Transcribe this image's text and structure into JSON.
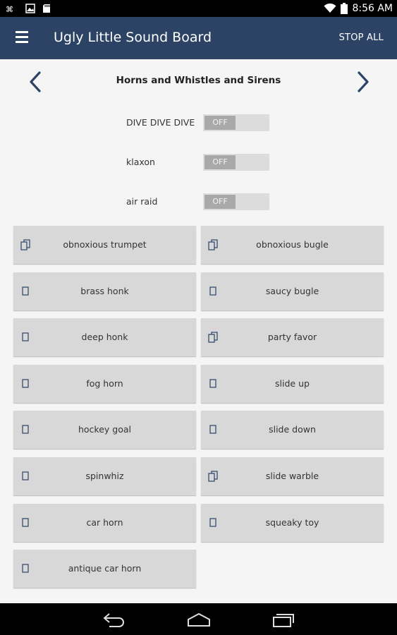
{
  "status_bar": {
    "time": "8:56 AM",
    "left_icons": [
      "voicemail-icon",
      "image-icon",
      "sd-card-icon"
    ],
    "right_icons": [
      "wifi-icon",
      "battery-icon"
    ]
  },
  "app_bar": {
    "title": "Ugly Little Sound Board",
    "stop_all_label": "STOP ALL",
    "background": "#2c4366"
  },
  "category": {
    "title": "Horns and Whistles and Sirens"
  },
  "toggles": [
    {
      "label": "DIVE DIVE DIVE",
      "state": "OFF"
    },
    {
      "label": "klaxon",
      "state": "OFF"
    },
    {
      "label": "air raid",
      "state": "OFF"
    }
  ],
  "sounds": [
    {
      "label": "obnoxious trumpet",
      "icon": "multi"
    },
    {
      "label": "obnoxious bugle",
      "icon": "multi"
    },
    {
      "label": "brass honk",
      "icon": "single"
    },
    {
      "label": "saucy bugle",
      "icon": "single"
    },
    {
      "label": "deep honk",
      "icon": "single"
    },
    {
      "label": "party favor",
      "icon": "multi"
    },
    {
      "label": "fog horn",
      "icon": "single"
    },
    {
      "label": "slide up",
      "icon": "single"
    },
    {
      "label": "hockey goal",
      "icon": "single"
    },
    {
      "label": "slide down",
      "icon": "single"
    },
    {
      "label": "spinwhiz",
      "icon": "single"
    },
    {
      "label": "slide warble",
      "icon": "multi"
    },
    {
      "label": "car horn",
      "icon": "single"
    },
    {
      "label": "squeaky toy",
      "icon": "single"
    },
    {
      "label": "antique car horn",
      "icon": "single"
    }
  ],
  "nav_bar": {
    "icons": [
      "back-icon",
      "home-icon",
      "recents-icon"
    ]
  }
}
